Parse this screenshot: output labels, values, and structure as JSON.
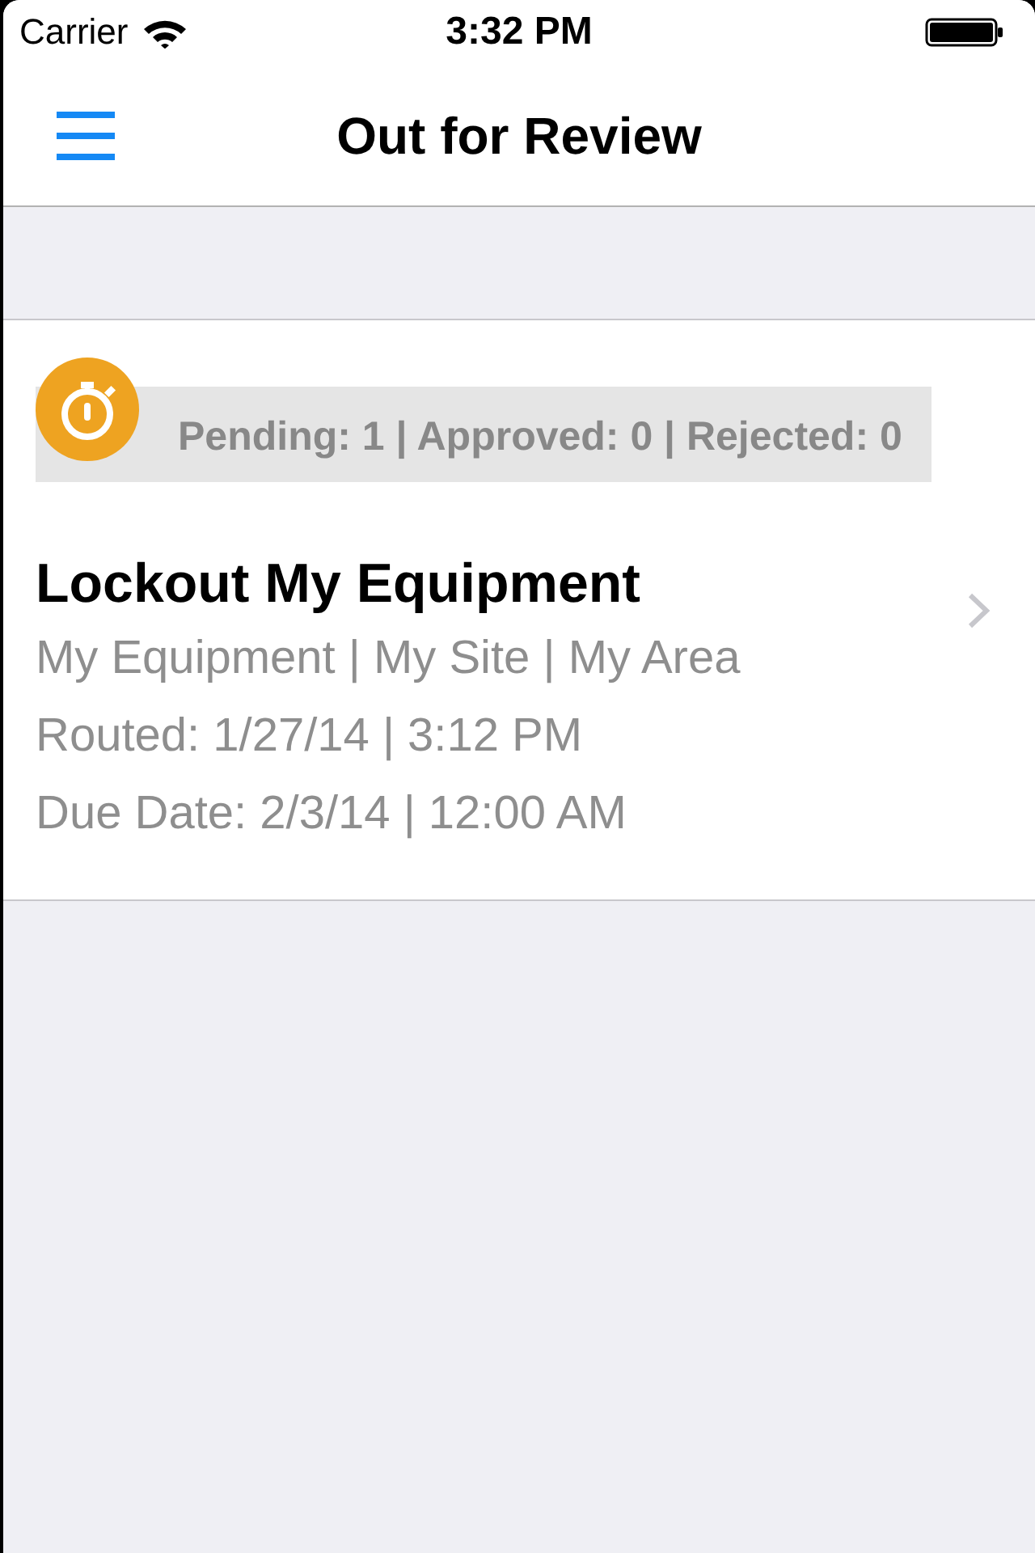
{
  "status_bar": {
    "carrier": "Carrier",
    "time": "3:32 PM"
  },
  "nav_bar": {
    "title": "Out for Review"
  },
  "items": [
    {
      "summary": "Pending: 1 | Approved: 0 | Rejected: 0",
      "title": "Lockout My Equipment",
      "details": [
        "My Equipment | My Site | My Area",
        "Routed: 1/27/14 | 3:12 PM",
        "Due Date: 2/3/14 | 12:00 AM"
      ]
    }
  ]
}
